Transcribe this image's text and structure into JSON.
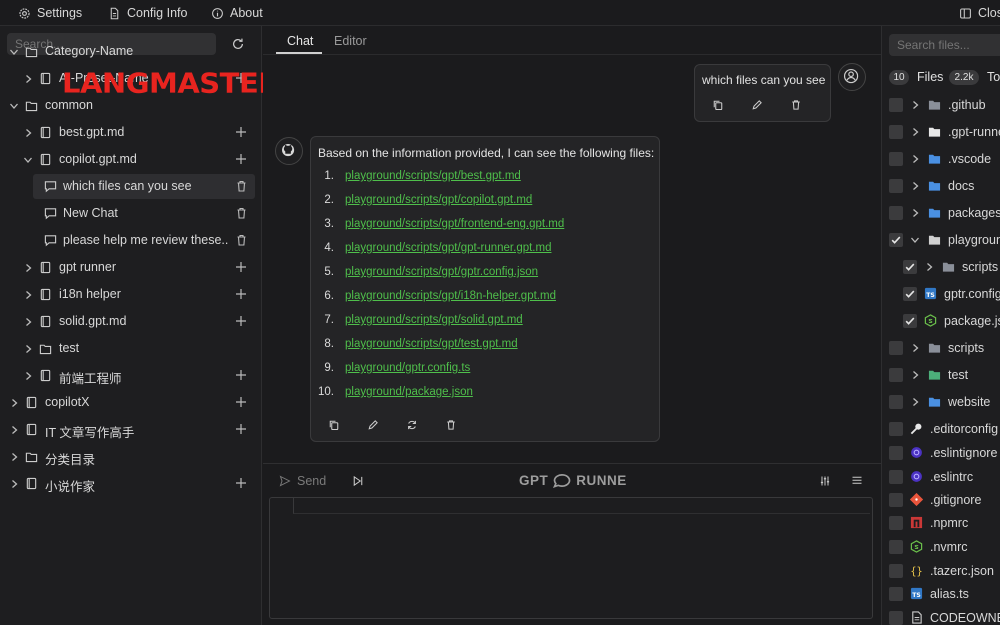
{
  "topbar": {
    "settings": "Settings",
    "config_info": "Config Info",
    "about": "About",
    "close": "Clos"
  },
  "watermark": "LANGMASTER",
  "sidebar": {
    "search_placeholder": "Search...",
    "items": [
      {
        "label": "Category-Name"
      },
      {
        "label": "AI-Preset-Name"
      },
      {
        "label": "common"
      },
      {
        "label": "best.gpt.md"
      },
      {
        "label": "copilot.gpt.md"
      },
      {
        "label": "which files can you see"
      },
      {
        "label": "New Chat"
      },
      {
        "label": "please help me review these..."
      },
      {
        "label": "gpt runner"
      },
      {
        "label": "i18n helper"
      },
      {
        "label": "solid.gpt.md"
      },
      {
        "label": "test"
      },
      {
        "label": "前端工程师"
      },
      {
        "label": "copilotX"
      },
      {
        "label": "IT 文章写作高手"
      },
      {
        "label": "分类目录"
      },
      {
        "label": "小说作家"
      }
    ]
  },
  "center": {
    "tabs": [
      {
        "label": "Chat"
      },
      {
        "label": "Editor"
      }
    ],
    "user_message": "which files can you see",
    "bot_intro": "Based on the information provided, I can see the following files:",
    "files": [
      {
        "num": "1.",
        "path": "playground/scripts/gpt/best.gpt.md"
      },
      {
        "num": "2.",
        "path": "playground/scripts/gpt/copilot.gpt.md"
      },
      {
        "num": "3.",
        "path": "playground/scripts/gpt/frontend-eng.gpt.md"
      },
      {
        "num": "4.",
        "path": "playground/scripts/gpt/gpt-runner.gpt.md"
      },
      {
        "num": "5.",
        "path": "playground/scripts/gpt/gptr.config.json"
      },
      {
        "num": "6.",
        "path": "playground/scripts/gpt/i18n-helper.gpt.md"
      },
      {
        "num": "7.",
        "path": "playground/scripts/gpt/solid.gpt.md"
      },
      {
        "num": "8.",
        "path": "playground/scripts/gpt/test.gpt.md"
      },
      {
        "num": "9.",
        "path": "playground/gptr.config.ts"
      },
      {
        "num": "10.",
        "path": "playground/package.json"
      }
    ],
    "send_label": "Send",
    "logo_left": "GPT",
    "logo_right": "RUNNE"
  },
  "right": {
    "search_placeholder": "Search files...",
    "files_count": "10",
    "files_label": "Files",
    "tokens_count": "2.2k",
    "tokens_label": "To",
    "files": [
      {
        "label": ".github"
      },
      {
        "label": ".gpt-runne"
      },
      {
        "label": ".vscode"
      },
      {
        "label": "docs"
      },
      {
        "label": "packages"
      },
      {
        "label": "playgroun"
      },
      {
        "label": "scripts"
      },
      {
        "label": "gptr.config"
      },
      {
        "label": "package.js"
      },
      {
        "label": "scripts"
      },
      {
        "label": "test"
      },
      {
        "label": "website"
      },
      {
        "label": ".editorconfig"
      },
      {
        "label": ".eslintignore"
      },
      {
        "label": ".eslintrc"
      },
      {
        "label": ".gitignore"
      },
      {
        "label": ".npmrc"
      },
      {
        "label": ".nvmrc"
      },
      {
        "label": ".tazerc.json"
      },
      {
        "label": "alias.ts"
      },
      {
        "label": "CODEOWNER"
      }
    ]
  },
  "colors": {
    "link": "#4fbf4b",
    "watermark": "#e8241f",
    "background": "#1b1b1d"
  }
}
